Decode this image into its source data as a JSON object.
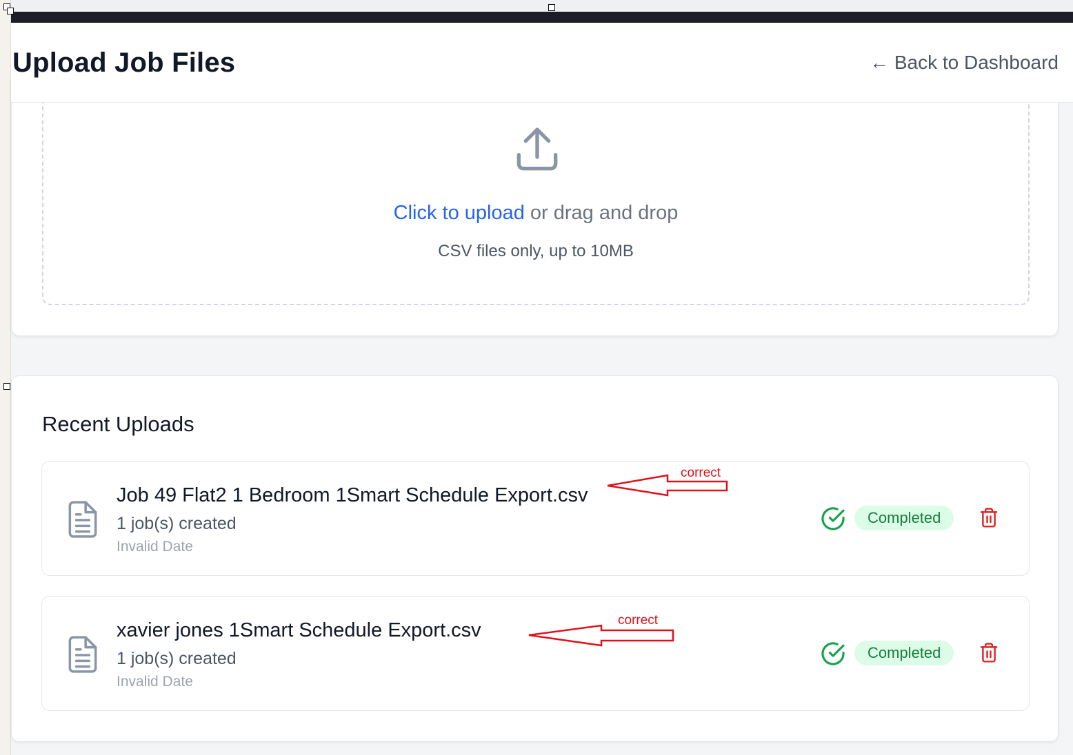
{
  "page": {
    "title": "Upload Job Files",
    "back_link": "← Back to Dashboard"
  },
  "upload": {
    "link_text": "Click to upload",
    "rest_text": " or drag and drop",
    "hint": "CSV files only, up to 10MB",
    "icon": "upload-icon"
  },
  "recent": {
    "title": "Recent Uploads",
    "items": [
      {
        "name": "Job 49 Flat2 1 Bedroom 1Smart Schedule Export.csv",
        "count": "1 job(s) created",
        "date": "Invalid Date",
        "status": "Completed",
        "annotation": "correct"
      },
      {
        "name": "xavier jones 1Smart Schedule Export.csv",
        "count": "1 job(s) created",
        "date": "Invalid Date",
        "status": "Completed",
        "annotation": "correct"
      }
    ]
  },
  "colors": {
    "link": "#2563eb",
    "success": "#16a34a",
    "badge_bg": "#dcfce7",
    "danger": "#dc2626",
    "annotation": "#e0111b"
  }
}
